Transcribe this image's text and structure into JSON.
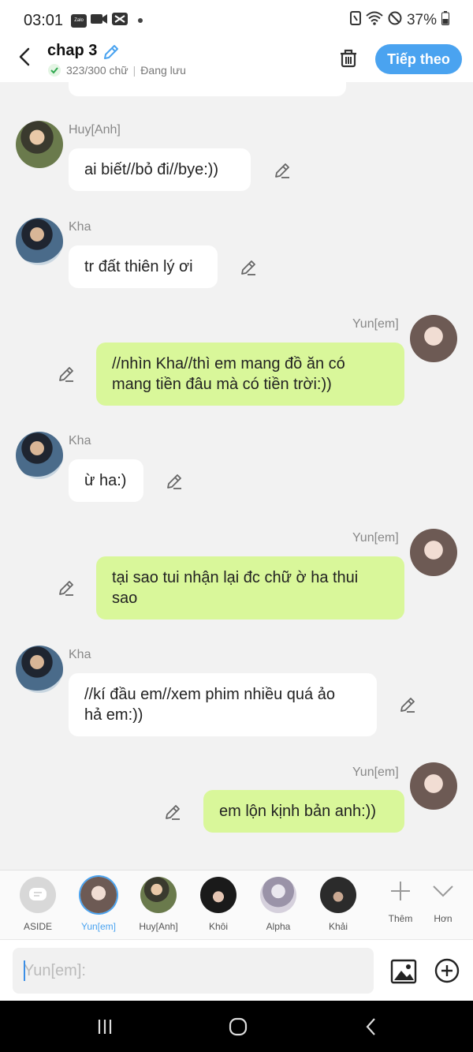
{
  "status": {
    "time": "03:01",
    "zalo": "Zalo",
    "battery": "37%"
  },
  "header": {
    "title": "chap 3",
    "word_count": "323/300 chữ",
    "saving_status": "Đang lưu",
    "next_label": "Tiếp theo"
  },
  "messages": [
    {
      "name": "Huy[Anh]",
      "text": "ai biết//bỏ đi//bye:))"
    },
    {
      "name": "Kha",
      "text": "tr đất thiên lý ơi"
    },
    {
      "name": "Yun[em]",
      "line1": "//nhìn Kha//thì em mang đồ ăn có",
      "line2": "mang tiền đâu mà có tiền trời:))"
    },
    {
      "name": "Kha",
      "text": "ừ ha:)"
    },
    {
      "name": "Yun[em]",
      "line1": "tại sao tui nhận lại đc chữ ờ ha thui",
      "line2": "sao"
    },
    {
      "name": "Kha",
      "line1": "//kí đầu em//xem phim nhiều quá ảo",
      "line2": "hả em:))"
    },
    {
      "name": "Yun[em]",
      "text": "em lộn kịnh bản anh:))"
    }
  ],
  "characters": [
    {
      "label": "ASIDE"
    },
    {
      "label": "Yun[em]"
    },
    {
      "label": "Huy[Anh]"
    },
    {
      "label": "Khôi"
    },
    {
      "label": "Alpha"
    },
    {
      "label": "Khải"
    }
  ],
  "tools": {
    "more_label": "Thêm",
    "less_label": "Hơn"
  },
  "input": {
    "placeholder": "Yun[em]:"
  },
  "colors": {
    "accent": "#4aa3f0",
    "right_bubble": "#d9f79a",
    "left_bubble": "#ffffff"
  },
  "icons": [
    "back-icon",
    "pencil-icon",
    "check-icon",
    "trash-icon",
    "image-icon",
    "plus-circle-icon",
    "plus-icon",
    "chevron-down-icon",
    "aside-icon",
    "nav-recents-icon",
    "nav-home-icon",
    "nav-back-icon"
  ]
}
